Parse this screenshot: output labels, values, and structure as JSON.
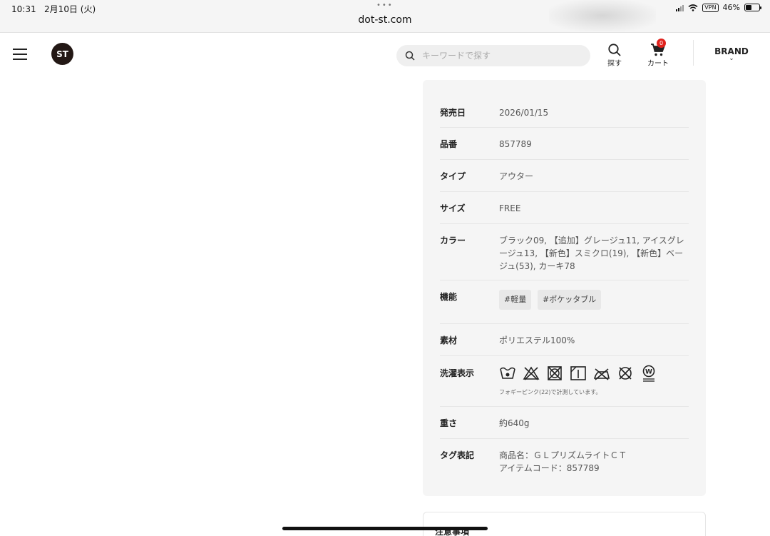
{
  "status": {
    "time": "10:31",
    "date": "2月10日 (火)",
    "url": "dot-st.com",
    "vpn": "VPN",
    "battery": "46%",
    "battery_level": 0.46
  },
  "header": {
    "logo_text": "ST",
    "search_placeholder": "キーワードで探す",
    "find_label": "探す",
    "cart_label": "カート",
    "cart_count": "0",
    "brand_label": "BRAND"
  },
  "specs": {
    "release": {
      "label": "発売日",
      "value": "2026/01/15"
    },
    "code": {
      "label": "品番",
      "value": "857789"
    },
    "type": {
      "label": "タイプ",
      "value": "アウター"
    },
    "size": {
      "label": "サイズ",
      "value": "FREE"
    },
    "color": {
      "label": "カラー",
      "value": "ブラック09, 【追加】グレージュ11, アイスグレージュ13, 【新色】スミクロ(19), 【新色】ベージュ(53), カーキ78"
    },
    "function": {
      "label": "機能",
      "tags": [
        "#軽量",
        "#ポケッタブル"
      ]
    },
    "material": {
      "label": "素材",
      "value": "ポリエステル100%"
    },
    "care": {
      "label": "洗濯表示",
      "icons": [
        "wash-30-icon",
        "no-bleach-icon",
        "no-tumble-dry-icon",
        "line-dry-shade-icon",
        "iron-low-icon",
        "no-dry-clean-icon",
        "wet-clean-icon"
      ],
      "note": "フォギーピンク(22)で計測しています。"
    },
    "weight": {
      "label": "重さ",
      "value": "約640g"
    },
    "tag": {
      "label": "タグ表記",
      "line1": "商品名：ＧＬプリズムライトＣＴ",
      "line2": "アイテムコード：857789"
    }
  },
  "notice": {
    "title": "注意事項"
  }
}
